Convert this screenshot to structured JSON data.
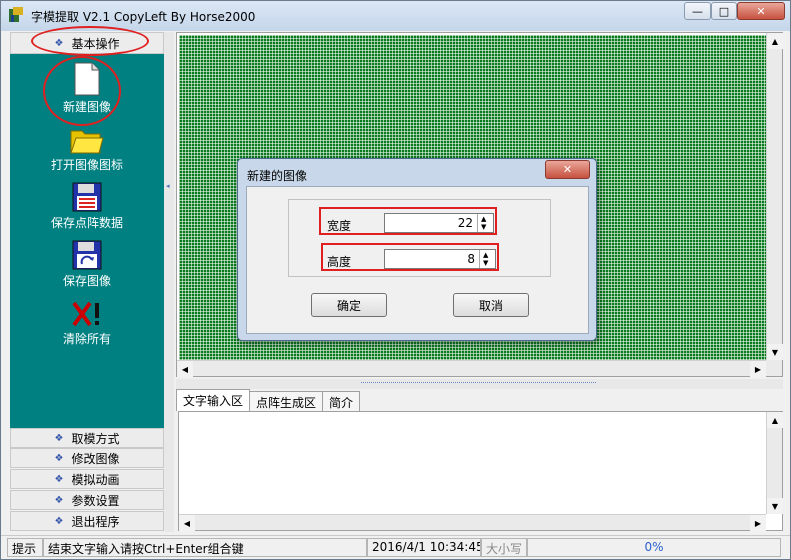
{
  "window": {
    "title": "字模提取 V2.1  CopyLeft By Horse2000",
    "min_symbol": "—",
    "max_symbol": "□",
    "close_symbol": "✕"
  },
  "sidebar": {
    "header_label": "基本操作",
    "tools": [
      {
        "label": "新建图像",
        "icon": "new-file-icon"
      },
      {
        "label": "打开图像图标",
        "icon": "open-folder-icon"
      },
      {
        "label": "保存点阵数据",
        "icon": "save-data-icon"
      },
      {
        "label": "保存图像",
        "icon": "save-image-icon"
      },
      {
        "label": "清除所有",
        "icon": "clear-icon"
      }
    ],
    "nav_items": [
      "取模方式",
      "修改图像",
      "模拟动画",
      "参数设置",
      "退出程序"
    ]
  },
  "tabs": [
    "文字输入区",
    "点阵生成区",
    "简介"
  ],
  "status": {
    "hint_label": "提示",
    "message": "结束文字输入请按Ctrl+Enter组合键",
    "datetime": "2016/4/1 10:34:45",
    "caps": "大小写",
    "progress": "0%"
  },
  "dialog": {
    "title": "新建的图像",
    "close_symbol": "✕",
    "width_label": "宽度",
    "width_value": "22",
    "height_label": "高度",
    "height_value": "8",
    "ok_label": "确定",
    "cancel_label": "取消"
  },
  "colors": {
    "sidebar_bg": "#008080",
    "grid_green": "#0a7a1e",
    "highlight_red": "#e02020"
  }
}
